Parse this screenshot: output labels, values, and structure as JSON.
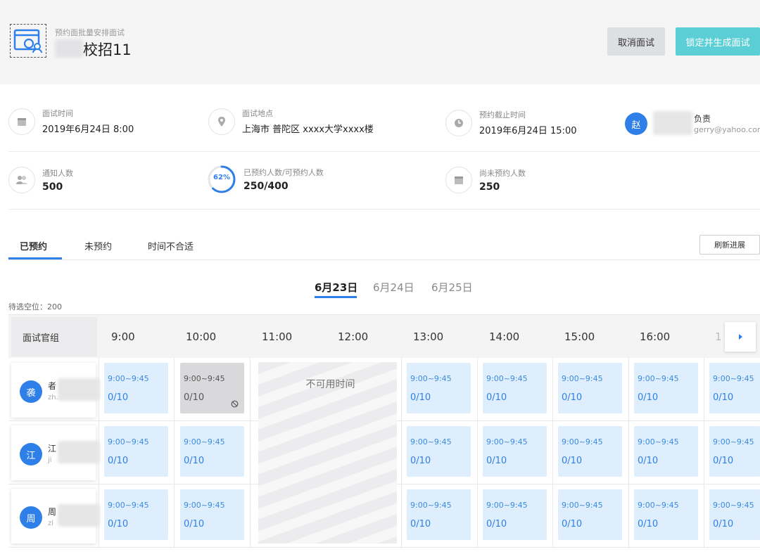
{
  "header": {
    "subtitle": "预约面批量安排面试",
    "title": "校招11",
    "cancel_label": "取消面试",
    "lock_label": "锁定并生成面试"
  },
  "info": {
    "time_label": "面试时间",
    "time_value": "2019年6月24日 8:00",
    "location_label": "面试地点",
    "location_value": "上海市 普陀区 xxxx大学xxxx楼",
    "deadline_label": "预约截止时间",
    "deadline_value": "2019年6月24日 15:00",
    "owner_avatar": "赵",
    "owner_role": "负责",
    "owner_email": "gerry@yahoo.com",
    "notify_label": "通知人数",
    "notify_value": "500",
    "progress_percent": "62%",
    "progress_fraction": 0.62,
    "booked_label": "已预约人数/可预约人数",
    "booked_value": "250/400",
    "unbooked_label": "尚未预约人数",
    "unbooked_value": "250"
  },
  "tabs": [
    "已预约",
    "未预约",
    "时间不合适"
  ],
  "refresh_label": "刷新进展",
  "dates": [
    "6月23日",
    "6月24日",
    "6月25日"
  ],
  "pending_text": "待选空位：200",
  "grid": {
    "group_header": "面试官组",
    "times": [
      "9:00",
      "10:00",
      "11:00",
      "12:00",
      "13:00",
      "14:00",
      "15:00",
      "16:00",
      "1"
    ],
    "unavailable_text": "不可用时间",
    "slot_time": "9:00~9:45",
    "slot_count": "0/10",
    "members": [
      {
        "avatar": "袭",
        "name": "者",
        "sub": "zh..."
      },
      {
        "avatar": "江",
        "name": "江",
        "sub": "ji"
      },
      {
        "avatar": "周",
        "name": "周",
        "sub": "zl"
      }
    ]
  },
  "colors": {
    "primary": "#2f7fe8",
    "accent": "#5ccfd6",
    "slot_bg": "#deeefc"
  }
}
